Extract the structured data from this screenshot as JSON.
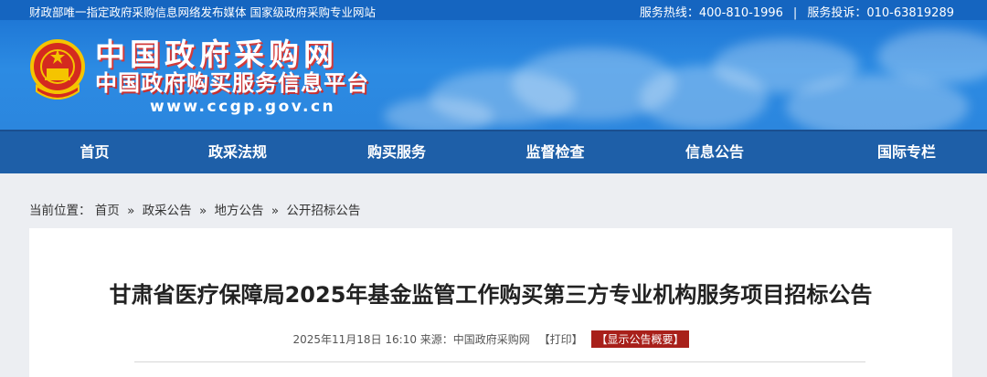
{
  "topbar": {
    "left_text": "财政部唯一指定政府采购信息网络发布媒体 国家级政府采购专业网站",
    "hotline": "服务热线：400-810-1996",
    "separator": "|",
    "complaint": "服务投诉：010-63819289"
  },
  "banner": {
    "site_name": "中国政府采购网",
    "site_subtitle": "中国政府购买服务信息平台",
    "site_url": "www.ccgp.gov.cn"
  },
  "nav": {
    "items": [
      "首页",
      "政采法规",
      "购买服务",
      "监督检查",
      "信息公告",
      "国际专栏"
    ]
  },
  "breadcrumb": {
    "prefix": "当前位置：",
    "items": [
      "首页",
      "政采公告",
      "地方公告",
      "公开招标公告"
    ],
    "separator": "»"
  },
  "article": {
    "title": "甘肃省医疗保障局2025年基金监管工作购买第三方专业机构服务项目招标公告",
    "date": "2025年11月18日 16:10",
    "source": "来源：中国政府采购网",
    "print_label": "【打印】",
    "summary_label": "【显示公告概要】"
  },
  "colors": {
    "topbar": "#1565c0",
    "banner": "#2a86de",
    "nav": "#1e5fa8",
    "badge": "#a8201a"
  }
}
